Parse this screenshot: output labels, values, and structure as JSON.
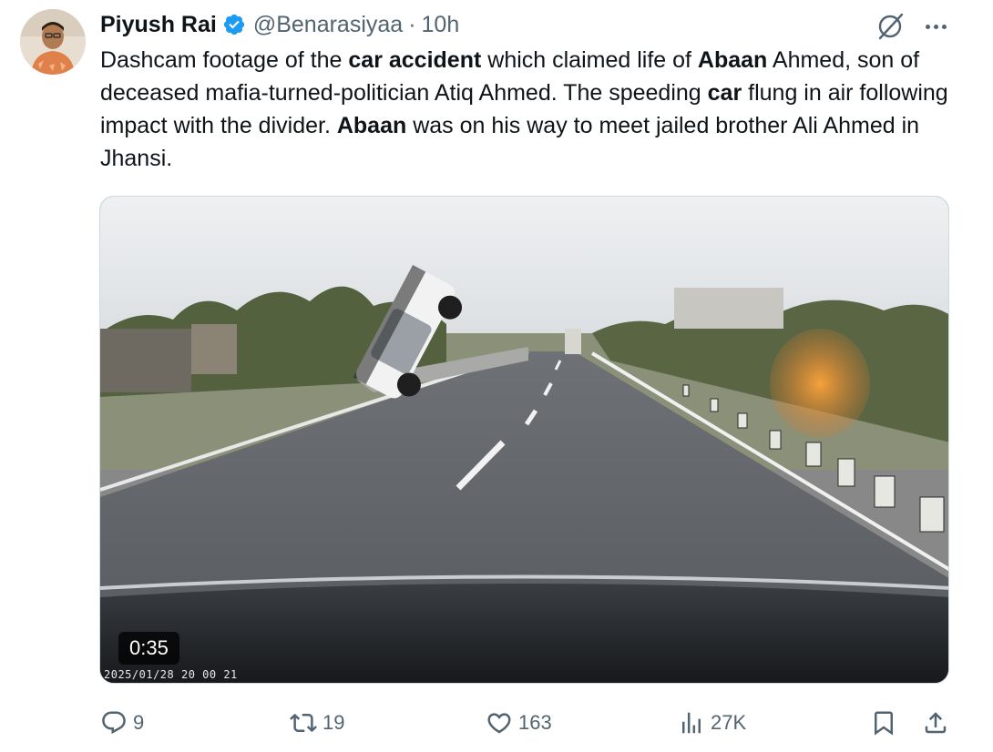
{
  "author": {
    "name": "Piyush Rai",
    "handle": "@Benarasiyaa",
    "separator": "·",
    "time": "10h",
    "verified": true
  },
  "tweet": {
    "segments": [
      {
        "text": "Dashcam footage of the ",
        "bold": false
      },
      {
        "text": "car accident",
        "bold": true
      },
      {
        "text": " which claimed life of ",
        "bold": false
      },
      {
        "text": "Abaan",
        "bold": true
      },
      {
        "text": " Ahmed, son of deceased mafia-turned-politician Atiq Ahmed. The speeding ",
        "bold": false
      },
      {
        "text": "car",
        "bold": true
      },
      {
        "text": " flung in air following impact with the divider. ",
        "bold": false
      },
      {
        "text": "Abaan",
        "bold": true
      },
      {
        "text": " was on his way to meet jailed brother Ali Ahmed in Jhansi.",
        "bold": false
      }
    ]
  },
  "media": {
    "duration": "0:35",
    "dashcam_timestamp": "2025/01/28 20 00 21"
  },
  "actions": {
    "replies": "9",
    "reposts": "19",
    "likes": "163",
    "views": "27K"
  },
  "icons": {
    "reply": "reply-icon",
    "repost": "repost-icon",
    "like": "heart-icon",
    "views": "views-icon",
    "bookmark": "bookmark-icon",
    "share": "share-icon",
    "more": "more-icon",
    "grok": "grok-icon",
    "verified": "verified-badge-icon"
  },
  "colors": {
    "verified_blue": "#1d9bf0",
    "secondary_text": "#536471",
    "primary_text": "#0f1419"
  }
}
